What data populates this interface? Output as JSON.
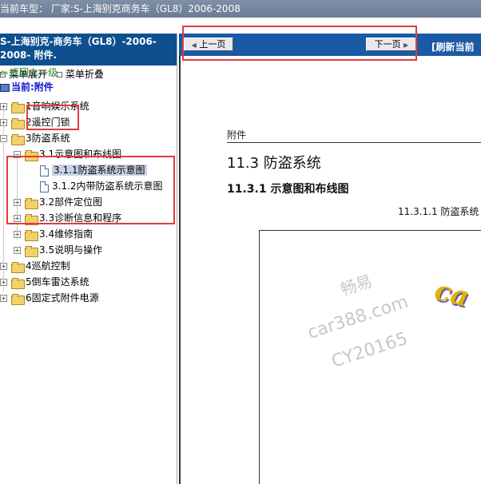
{
  "topbar": {
    "text": "当前车型： 厂家:S-上海别克商务车（GL8）2006-2008"
  },
  "sidebar": {
    "header": "S-上海别克-商务车（GL8）-2006-2008- 附件.",
    "expand_all": "菜单展开",
    "collapse_all": "菜单折叠",
    "back": "返回上一级",
    "current": "当前:附件",
    "items": [
      {
        "label": "1音响娱乐系统"
      },
      {
        "label": "2遥控门锁"
      },
      {
        "label": "3防盗系统"
      },
      {
        "label": "3.1示意图和布线图"
      },
      {
        "label": "3.1.1防盗系统示意图"
      },
      {
        "label": "3.1.2内带防盗系统示意图"
      },
      {
        "label": "3.2部件定位图"
      },
      {
        "label": "3.3诊断信息和程序"
      },
      {
        "label": "3.4维修指南"
      },
      {
        "label": "3.5说明与操作"
      },
      {
        "label": "4巡航控制"
      },
      {
        "label": "5倒车雷达系统"
      },
      {
        "label": "6固定式附件电源"
      }
    ]
  },
  "nav": {
    "prev": "上一页",
    "next": "下一页",
    "refresh": "[刷新当前"
  },
  "document": {
    "section_label": "附件",
    "title": "11.3 防盗系统",
    "subtitle": "11.3.1 示意图和布线图",
    "figure_title": "11.3.1.1 防盗系统",
    "watermark_1": "畅易",
    "watermark_2": "car388.com",
    "watermark_3": "CY20165",
    "logo_text": "ca"
  }
}
